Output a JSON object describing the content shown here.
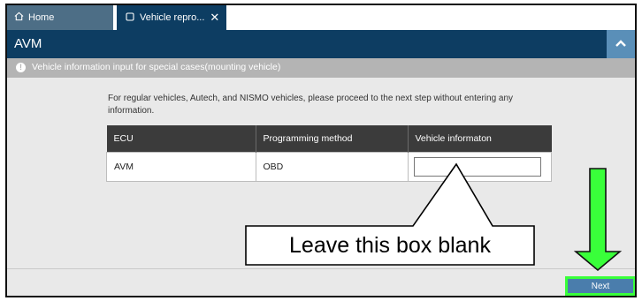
{
  "tabs": [
    {
      "label": "Home",
      "icon": "home-icon"
    },
    {
      "label": "Vehicle repro...",
      "icon": "window-icon",
      "close": "✕"
    }
  ],
  "header": {
    "title": "AVM"
  },
  "info_bar": {
    "text": "Vehicle information input for special cases(mounting vehicle)"
  },
  "instruction": "For regular vehicles, Autech, and NISMO vehicles, please proceed to the next step without entering any information.",
  "table": {
    "headers": [
      "ECU",
      "Programming method",
      "Vehicle informaton"
    ],
    "rows": [
      {
        "ecu": "AVM",
        "method": "OBD",
        "vehicle_info": ""
      }
    ]
  },
  "callout": {
    "text": "Leave this box blank"
  },
  "footer": {
    "next_label": "Next"
  },
  "colors": {
    "header_bg": "#0d3d62",
    "tab_home_bg": "#4d6e86",
    "info_bar_bg": "#b4b4b4",
    "table_header_bg": "#3b3b3b",
    "next_button": "#4a7dac",
    "highlight_green": "#39ff3a"
  }
}
